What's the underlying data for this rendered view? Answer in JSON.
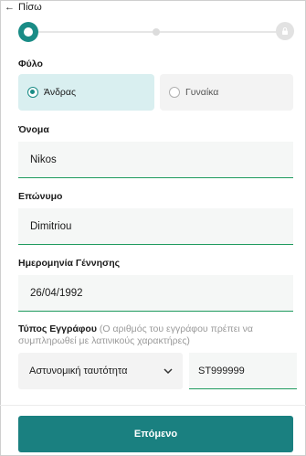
{
  "nav": {
    "back_label": "Πίσω"
  },
  "stepper": {
    "current_step": 1,
    "total_steps": 3
  },
  "gender": {
    "label": "Φύλο",
    "options": [
      {
        "label": "Άνδρας",
        "selected": true
      },
      {
        "label": "Γυναίκα",
        "selected": false
      }
    ]
  },
  "first_name": {
    "label": "Όνομα",
    "value": "Nikos"
  },
  "last_name": {
    "label": "Επώνυμο",
    "value": "Dimitriou"
  },
  "birth_date": {
    "label": "Ημερομηνία Γέννησης",
    "value": "26/04/1992"
  },
  "document": {
    "label": "Τύπος Εγγράφου",
    "hint": "(Ο αριθμός του εγγράφου πρέπει να συμπληρωθεί με λατινικούς χαρακτήρες)",
    "type_value": "Αστυνομική ταυτότητα",
    "number_value": "ST999999"
  },
  "next_button": {
    "label": "Επόμενο"
  },
  "colors": {
    "accent": "#1a8c86",
    "valid_underline": "#1f9a5e",
    "button": "#1a8080",
    "selected_bg": "#d9eff0"
  },
  "icons": {
    "back": "arrow-left-icon",
    "select": "chevron-down-icon",
    "final_step": "lock-icon"
  }
}
